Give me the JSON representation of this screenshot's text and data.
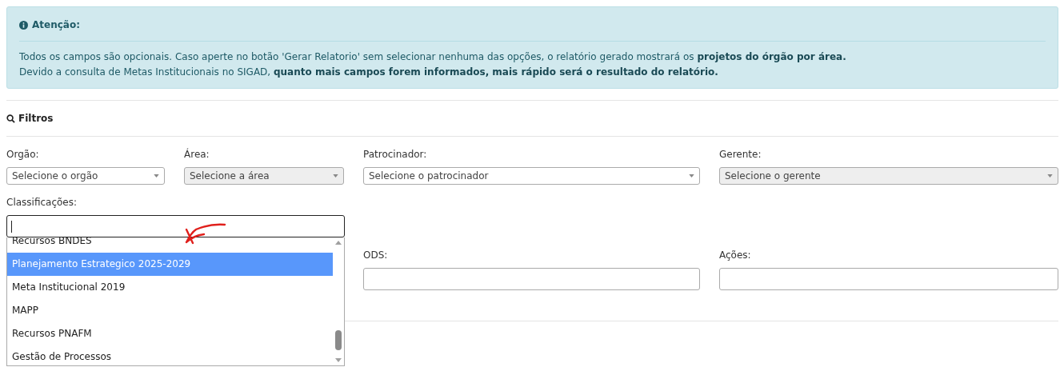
{
  "alert": {
    "title": "Atenção:",
    "lines": [
      "Todos os campos são opcionais. Caso aperte no botão 'Gerar Relatorio' sem selecionar nenhuma das opções, o relatório gerado mostrará os **projetos do órgão por área.**",
      "Devido a consulta de Metas Institucionais no SIGAD, **quanto mais campos forem informados, mais rápido será o resultado do relatório.**"
    ]
  },
  "filters": {
    "title": "Filtros",
    "rows": [
      {
        "fields": [
          {
            "label": "Orgão:",
            "kind": "select",
            "placeholder": "Selecione o orgão",
            "disabled": false
          },
          {
            "label": "Área:",
            "kind": "select",
            "placeholder": "Selecione a área",
            "disabled": true
          },
          {
            "label": "Patrocinador:",
            "kind": "select",
            "placeholder": "Selecione o patrocinador",
            "disabled": false
          },
          {
            "label": "Gerente:",
            "kind": "select",
            "placeholder": "Selecione o gerente",
            "disabled": true
          }
        ]
      },
      {
        "fields": [
          {
            "label": "Classificações:",
            "kind": "combo",
            "expanded": true,
            "options": [
              {
                "label": "Recursos BNDES",
                "selected": false
              },
              {
                "label": "Planejamento Estrategico 2025-2029",
                "selected": true
              },
              {
                "label": "Meta Institucional 2019",
                "selected": false
              },
              {
                "label": "MAPP",
                "selected": false
              },
              {
                "label": "Recursos PNAFM",
                "selected": false
              },
              {
                "label": "Gestão de Processos",
                "selected": false
              }
            ]
          }
        ]
      },
      {
        "fields": [
          {
            "label": "ODS:",
            "kind": "text",
            "disabled": false
          },
          {
            "label": "Ações:",
            "kind": "text",
            "disabled": false
          }
        ]
      }
    ]
  }
}
